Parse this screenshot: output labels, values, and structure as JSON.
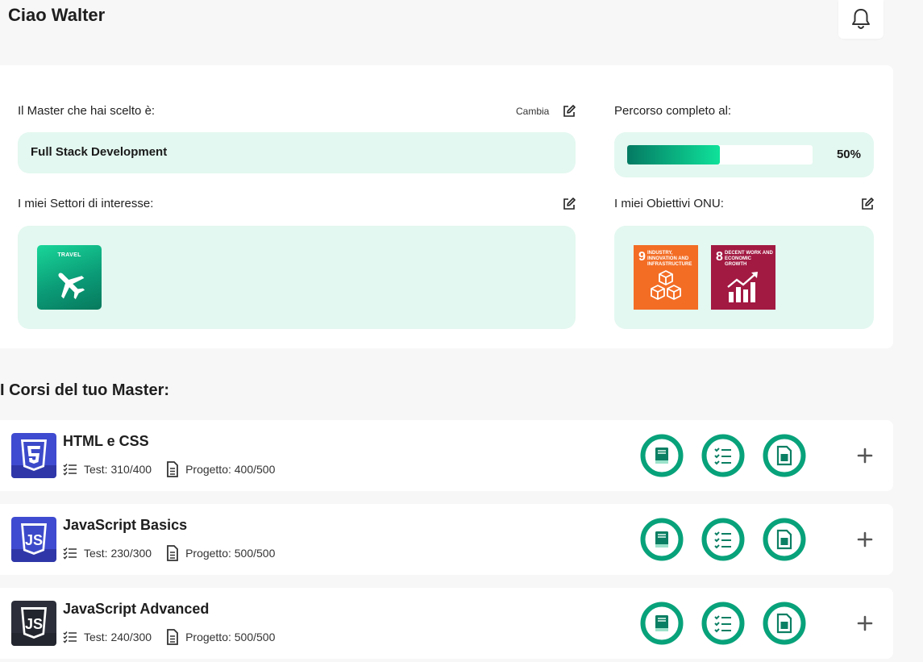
{
  "header": {
    "greeting": "Ciao Walter"
  },
  "master": {
    "label": "Il Master che hai scelto è:",
    "change_label": "Cambia",
    "name": "Full Stack Development"
  },
  "progress": {
    "label": "Percorso completo al:",
    "percent": 50,
    "percent_text": "50%"
  },
  "sectors": {
    "label": "I miei Settori di interesse:",
    "items": [
      {
        "name": "TRAVEL",
        "icon": "airplane-icon",
        "color": "#0b9c77"
      }
    ]
  },
  "goals": {
    "label": "I miei Obiettivi ONU:",
    "items": [
      {
        "number": "9",
        "text": "INDUSTRY, INNOVATION AND INFRASTRUCTURE",
        "color": "#f36d25",
        "icon": "cubes-icon"
      },
      {
        "number": "8",
        "text": "DECENT WORK AND ECONOMIC GROWTH",
        "color": "#a21942",
        "icon": "growth-chart-icon"
      }
    ]
  },
  "courses_section": {
    "title": "I Corsi del tuo Master:",
    "courses": [
      {
        "title": "HTML e CSS",
        "test": "Test: 310/400",
        "project": "Progetto: 400/500",
        "logo": "html5-icon",
        "logo_text": "5"
      },
      {
        "title": "JavaScript Basics",
        "test": "Test: 230/300",
        "project": "Progetto: 500/500",
        "logo": "js-icon",
        "logo_text": "JS"
      },
      {
        "title": "JavaScript Advanced",
        "test": "Test: 240/300",
        "project": "Progetto: 500/500",
        "logo": "js-dark-icon",
        "logo_text": "JS"
      }
    ]
  },
  "colors": {
    "accent": "#0fae86",
    "mint": "#e3f8f0",
    "ring": "#0a9f7a"
  }
}
